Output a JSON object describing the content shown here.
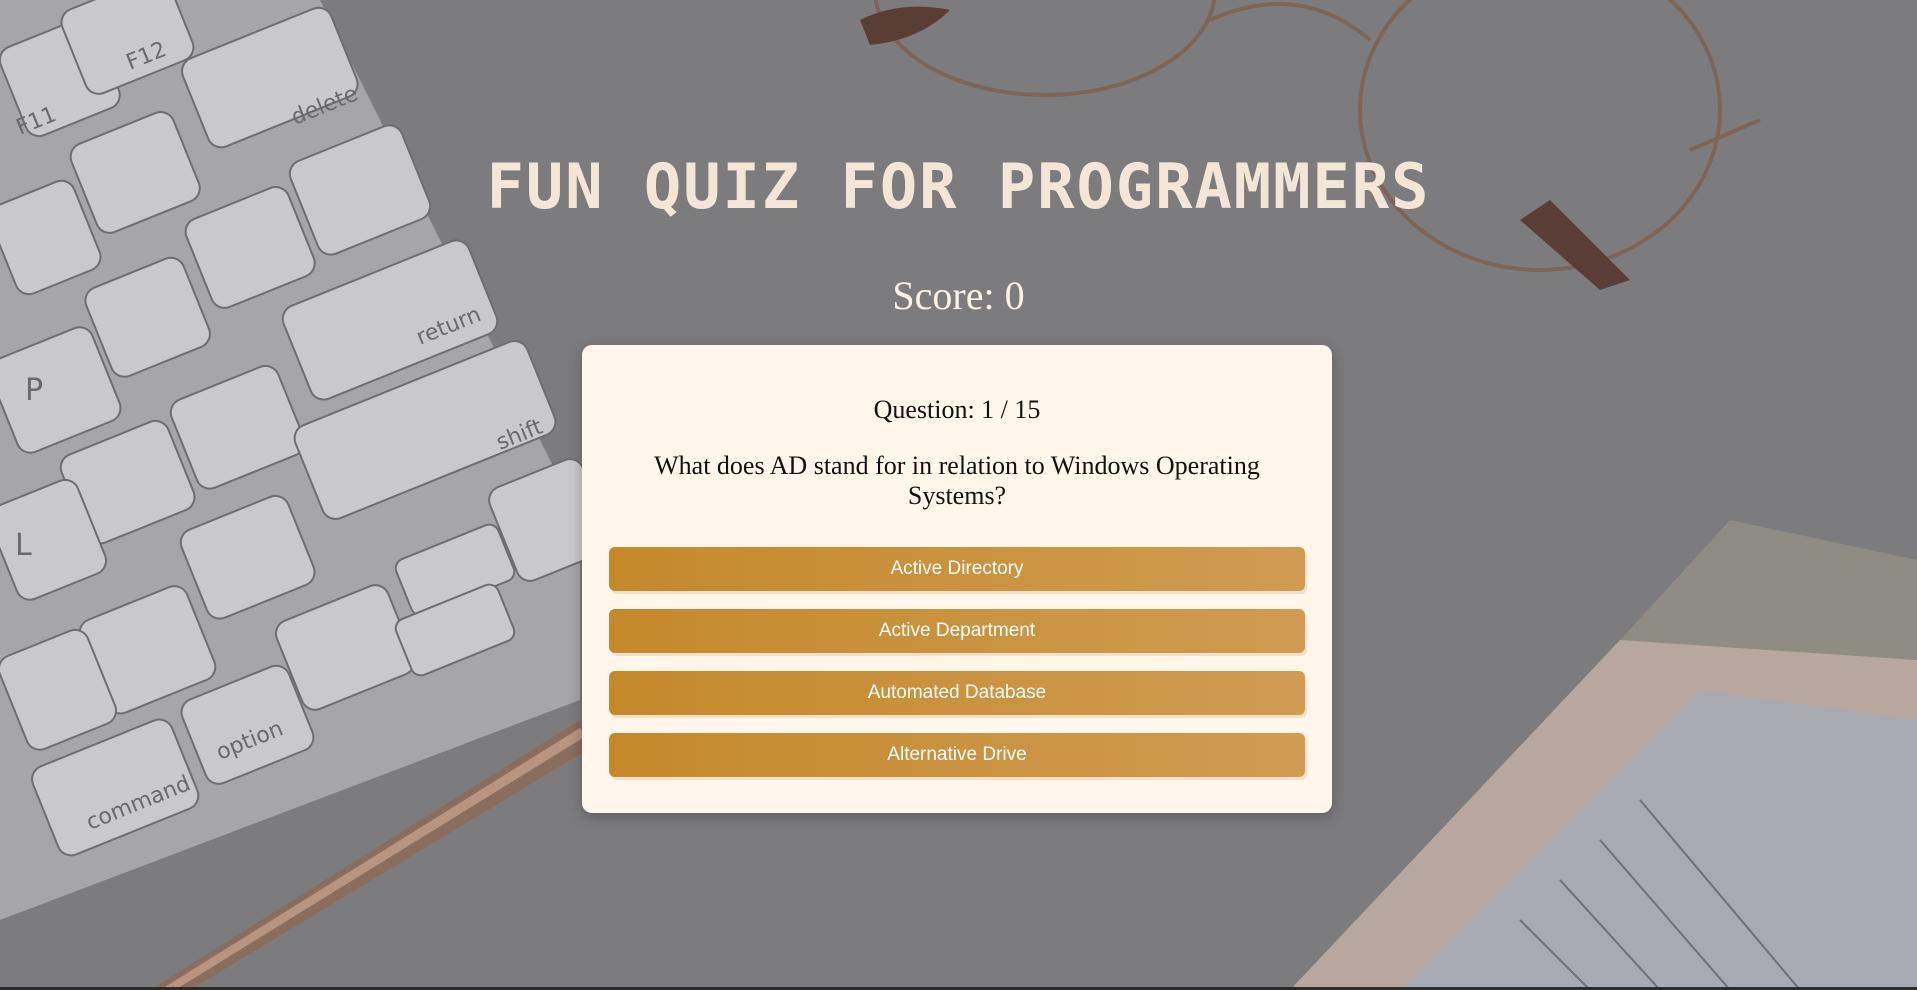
{
  "header": {
    "title": "FUN QUIZ FOR PROGRAMMERS",
    "score": "Score: 0"
  },
  "quiz": {
    "question_counter": "Question: 1 / 15",
    "question_text": "What does AD stand for in relation to Windows Operating Systems?",
    "answers": [
      {
        "label": "Active Directory"
      },
      {
        "label": "Active Department"
      },
      {
        "label": "Automated Database"
      },
      {
        "label": "Alternative Drive"
      }
    ]
  },
  "keyboard_labels": [
    "F11",
    "F12",
    "delete",
    "return",
    "shift",
    "option",
    "command",
    "P",
    "L"
  ],
  "colors": {
    "background": "#7b7b7d",
    "title": "#f3e6d6",
    "card": "#fff7ec",
    "button_start": "#c5892a",
    "button_end": "#d09c52"
  }
}
